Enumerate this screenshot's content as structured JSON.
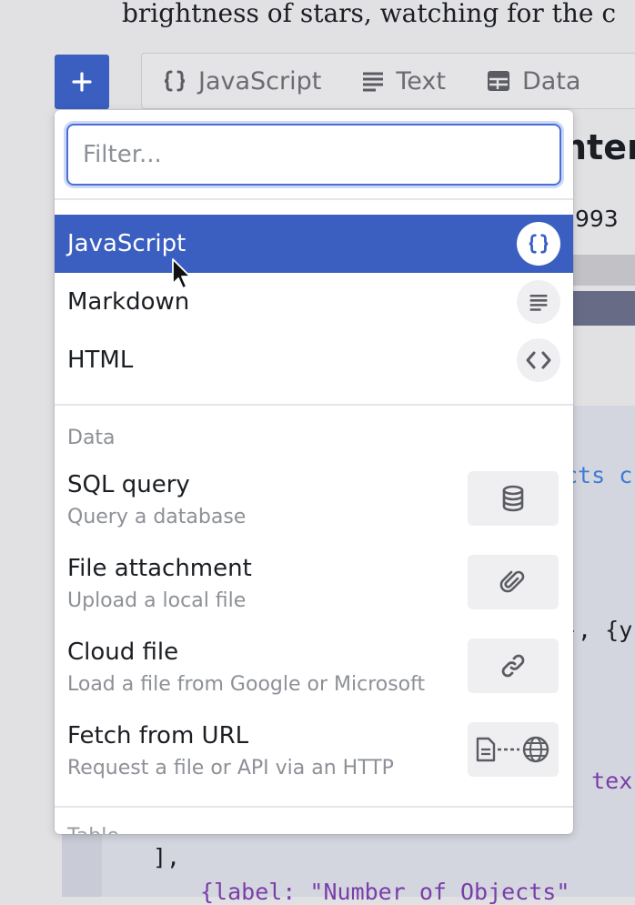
{
  "background": {
    "prose_text": "brightness of stars, watching for the c",
    "add_button_symbol": "+",
    "cell_tabs": [
      {
        "label": "JavaScript",
        "icon": "braces-icon"
      },
      {
        "label": "Text",
        "icon": "text-lines-icon"
      },
      {
        "label": "Data",
        "icon": "table-icon"
      }
    ],
    "title_fragment": "nter",
    "number_fragment": "993",
    "code_fragments": {
      "line1": "cts c",
      "line2": "-, {y",
      "line3": ". tex",
      "line4": "],",
      "line5": "{label: \"Number of Objects\""
    }
  },
  "menu": {
    "filter_placeholder": "Filter...",
    "items": [
      {
        "label": "JavaScript",
        "icon": "braces-icon",
        "selected": true
      },
      {
        "label": "Markdown",
        "icon": "text-lines-icon",
        "selected": false
      },
      {
        "label": "HTML",
        "icon": "code-brackets-icon",
        "selected": false
      }
    ],
    "section_data_label": "Data",
    "data_items": [
      {
        "title": "SQL query",
        "subtitle": "Query a database",
        "icon": "database-icon"
      },
      {
        "title": "File attachment",
        "subtitle": "Upload a local file",
        "icon": "paperclip-icon"
      },
      {
        "title": "Cloud file",
        "subtitle": "Load a file from Google or Microsoft",
        "icon": "link-icon"
      },
      {
        "title": "Fetch from URL",
        "subtitle": "Request a file or API via an HTTP",
        "icon": "file-globe-icon"
      }
    ],
    "next_section_label": "Table"
  },
  "colors": {
    "accent": "#3b5fc0",
    "focus_ring": "#4a6fd6"
  }
}
